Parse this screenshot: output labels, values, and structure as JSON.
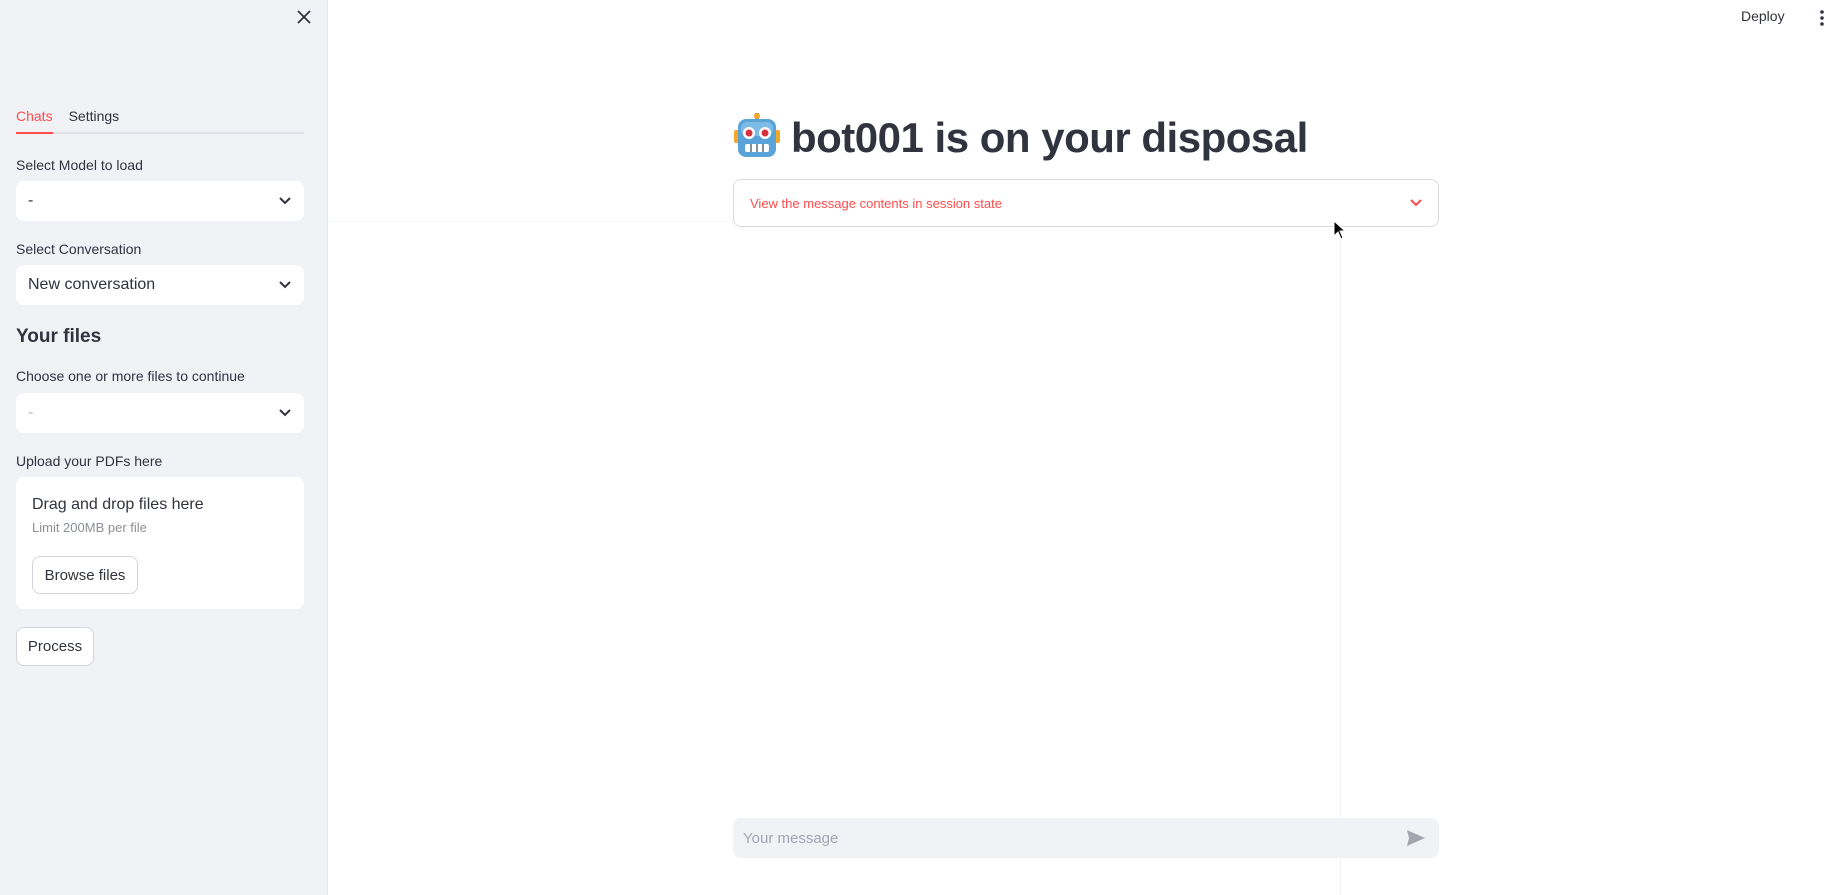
{
  "sidebar": {
    "tabs": [
      {
        "label": "Chats",
        "active": true
      },
      {
        "label": "Settings",
        "active": false
      }
    ],
    "model_select": {
      "label": "Select Model to load",
      "value": "-"
    },
    "conversation_select": {
      "label": "Select Conversation",
      "value": "New conversation"
    },
    "files_section_title": "Your files",
    "files_select": {
      "label": "Choose one or more files to continue",
      "placeholder": "-"
    },
    "upload": {
      "label": "Upload your PDFs here",
      "title": "Drag and drop files here",
      "limit": "Limit 200MB per file",
      "browse_label": "Browse files"
    },
    "process_label": "Process"
  },
  "header": {
    "deploy_label": "Deploy"
  },
  "main": {
    "title": "bot001 is on your disposal",
    "title_emoji": "robot-face",
    "expander_label": "View the message contents in session state",
    "chat_placeholder": "Your message"
  },
  "colors": {
    "accent": "#ff4b4b",
    "sidebar_bg": "#f0f2f6",
    "text": "#31333f"
  }
}
